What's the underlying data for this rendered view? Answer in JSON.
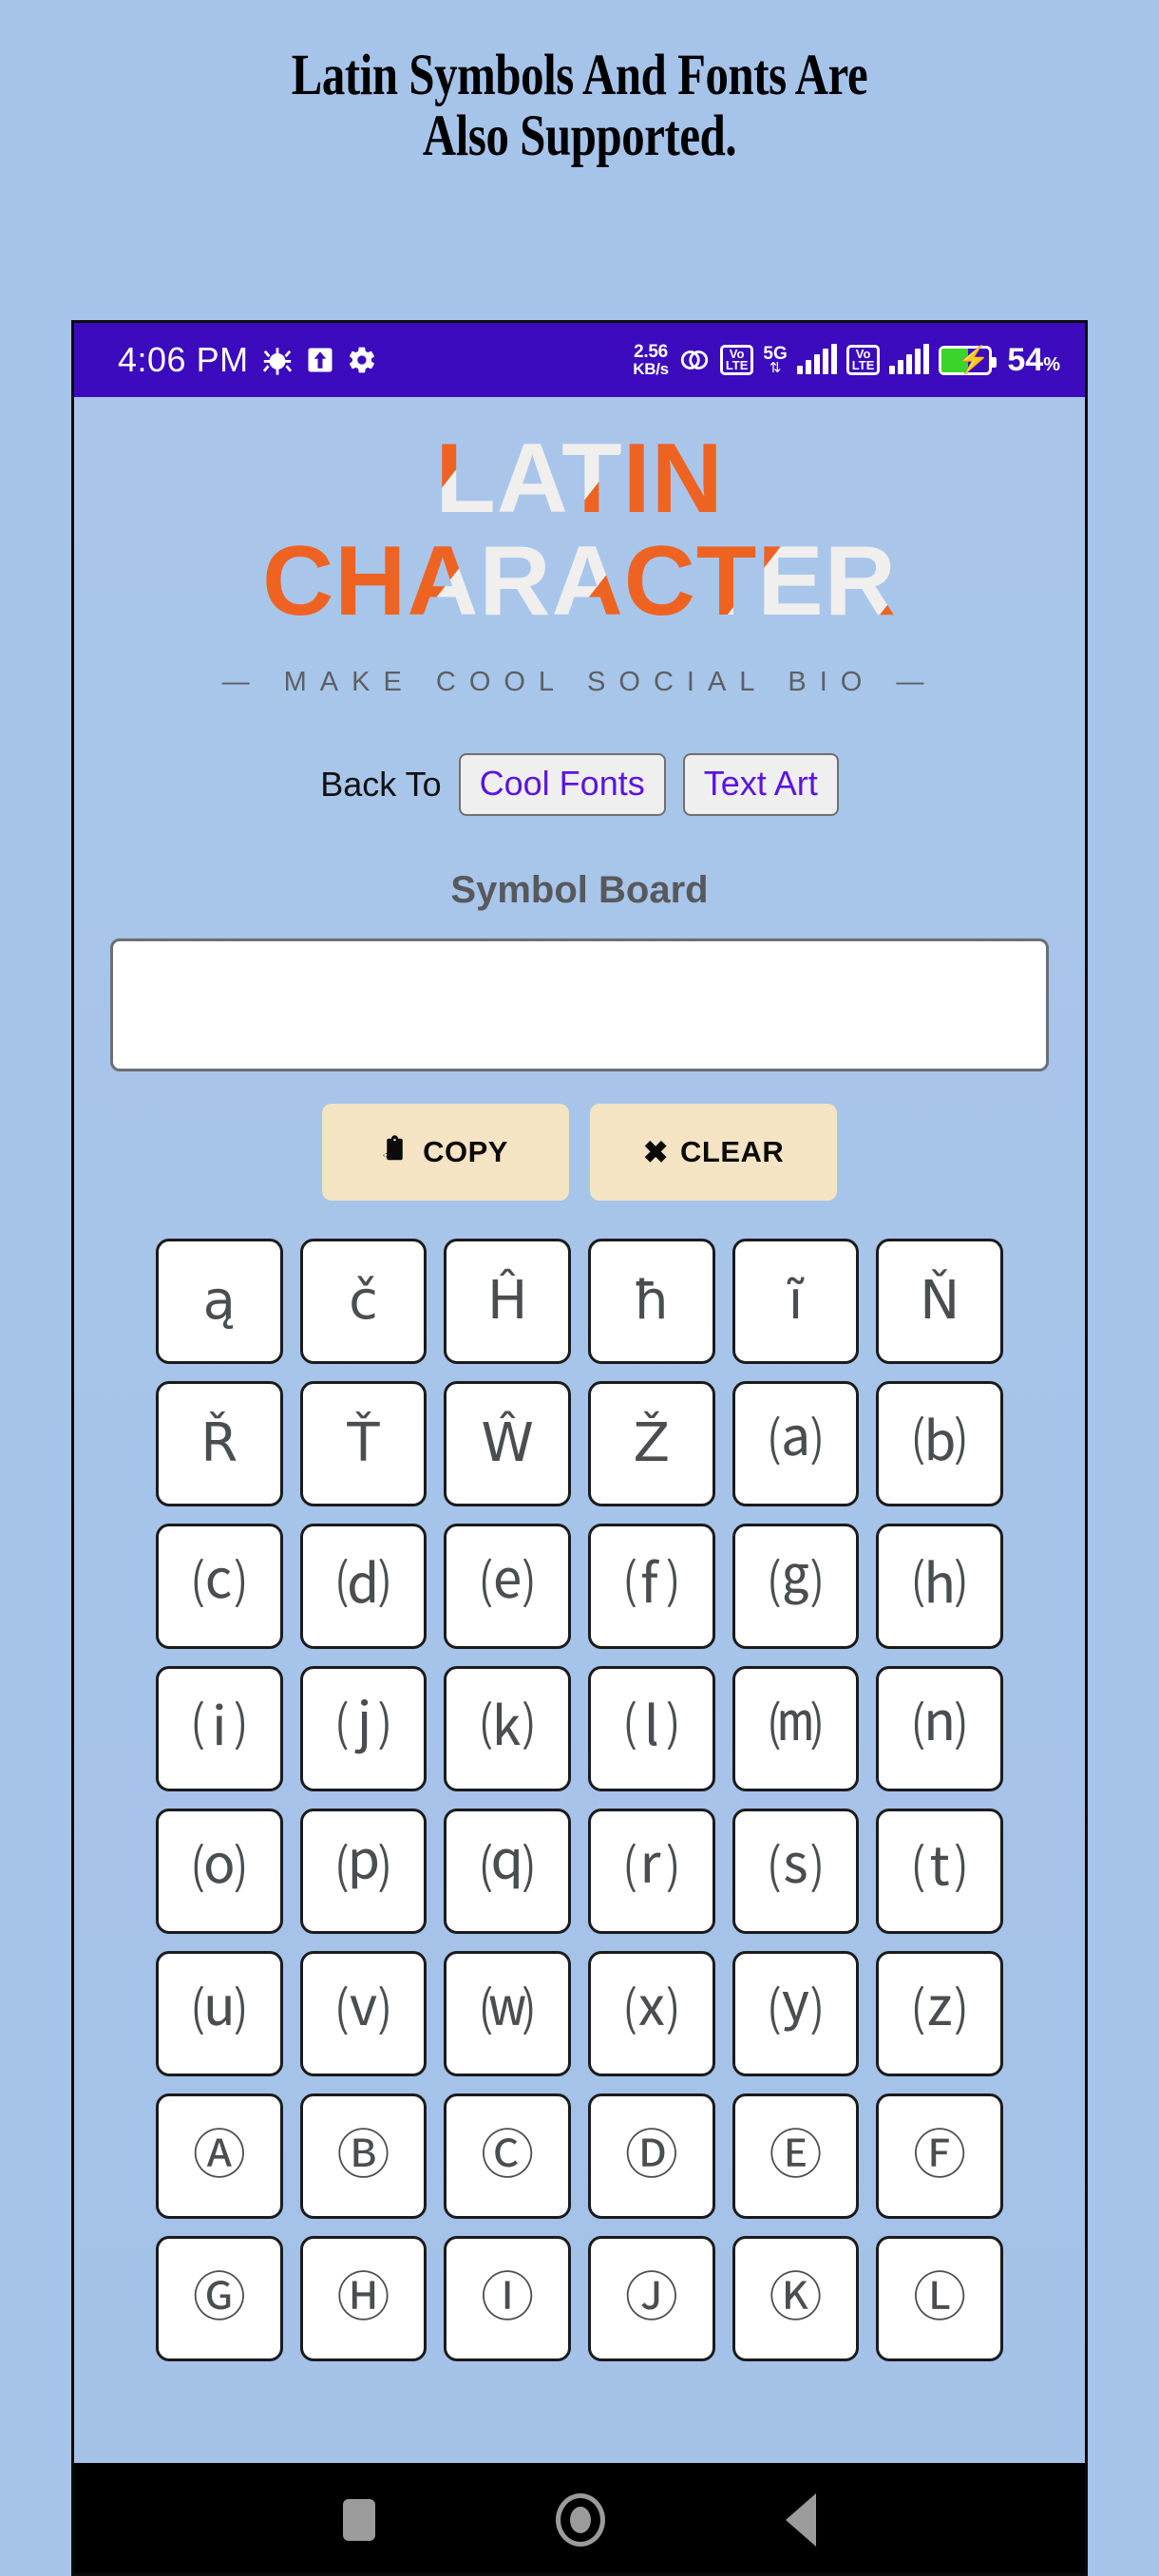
{
  "banner": {
    "line1": "Latin Symbols And Fonts Are",
    "line2": "Also Supported."
  },
  "statusbar": {
    "time": "4:06 PM",
    "left_icons": [
      "bug-icon",
      "upload-arrow-icon",
      "gear-icon"
    ],
    "net_speed_value": "2.56",
    "net_speed_unit": "KB/s",
    "sync_icon": "sync-circles-icon",
    "volte1": "VoLTE",
    "network_type": "5G",
    "data_arrows": "⇅",
    "volte2": "VoLTE",
    "battery_percent": "54",
    "battery_percent_suffix": "%",
    "battery_state": "charging",
    "bg_color": "#3b0bbd"
  },
  "app": {
    "hero_line1": "LATIN",
    "hero_line2": "CHARACTER",
    "hero_colors": [
      "#ee6322",
      "#f0efee"
    ],
    "tagline": "— MAKE COOL SOCIAL BIO —",
    "back_to_label": "Back To",
    "nav_links": [
      {
        "label": "Cool Fonts"
      },
      {
        "label": "Text Art"
      }
    ],
    "link_color": "#5b14e0",
    "board_title": "Symbol Board",
    "board_input_value": "",
    "board_input_placeholder": "",
    "actions": [
      {
        "label": "COPY",
        "icon": "clipboard-paste-icon",
        "glyph": "📋"
      },
      {
        "label": "CLEAR",
        "icon": "close-x-icon",
        "glyph": "✖"
      }
    ],
    "action_bg": "#f4e4c3",
    "symbols": [
      "ą",
      "č",
      "Ĥ",
      "ħ",
      "ĩ",
      "Ň",
      "Ř",
      "Ť",
      "Ŵ",
      "Ž",
      "⒜",
      "⒝",
      "⒞",
      "⒟",
      "⒠",
      "⒡",
      "⒢",
      "⒣",
      "⒤",
      "⒥",
      "⒦",
      "⒧",
      "⒨",
      "⒩",
      "⒪",
      "⒫",
      "⒬",
      "⒭",
      "⒮",
      "⒯",
      "⒰",
      "⒱",
      "⒲",
      "⒳",
      "⒴",
      "⒵",
      "Ⓐ",
      "Ⓑ",
      "Ⓒ",
      "Ⓓ",
      "Ⓔ",
      "Ⓕ",
      "Ⓖ",
      "Ⓗ",
      "Ⓘ",
      "Ⓙ",
      "Ⓚ",
      "Ⓛ"
    ]
  },
  "navbar": {
    "buttons": [
      "recent-apps",
      "home",
      "back"
    ]
  }
}
